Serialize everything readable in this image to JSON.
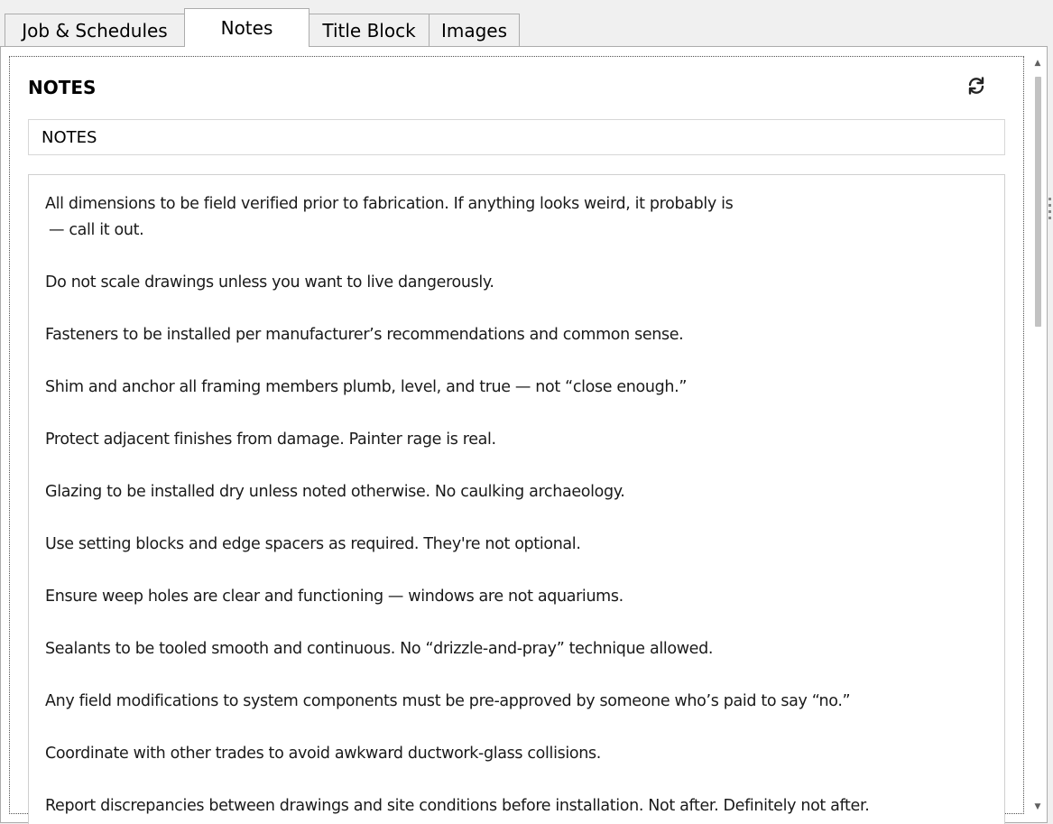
{
  "tabs": [
    {
      "label": "Job & Schedules",
      "active": false
    },
    {
      "label": "Notes",
      "active": true
    },
    {
      "label": "Title Block",
      "active": false
    },
    {
      "label": "Images",
      "active": false
    }
  ],
  "notes_panel": {
    "heading": "NOTES",
    "refresh_icon": "refresh-icon",
    "title_field_value": "NOTES",
    "body_lines": [
      "All dimensions to be field verified prior to fabrication. If anything looks weird, it probably is",
      " — call it out.",
      "",
      "Do not scale drawings unless you want to live dangerously.",
      "",
      "Fasteners to be installed per manufacturer’s recommendations and common sense.",
      "",
      "Shim and anchor all framing members plumb, level, and true — not “close enough.”",
      "",
      "Protect adjacent finishes from damage. Painter rage is real.",
      "",
      "Glazing to be installed dry unless noted otherwise. No caulking archaeology.",
      "",
      "Use setting blocks and edge spacers as required. They're not optional.",
      "",
      "Ensure weep holes are clear and functioning — windows are not aquariums.",
      "",
      "Sealants to be tooled smooth and continuous. No “drizzle-and-pray” technique allowed.",
      "",
      "Any field modifications to system components must be pre-approved by someone who’s paid to say “no.”",
      "",
      "Coordinate with other trades to avoid awkward ductwork-glass collisions.",
      "",
      "Report discrepancies between drawings and site conditions before installation. Not after. Definitely not after."
    ]
  },
  "colors": {
    "window_bg": "#f0f0f0",
    "panel_bg": "#ffffff",
    "border": "#acacac",
    "scroll_thumb": "#c2c2c2"
  }
}
